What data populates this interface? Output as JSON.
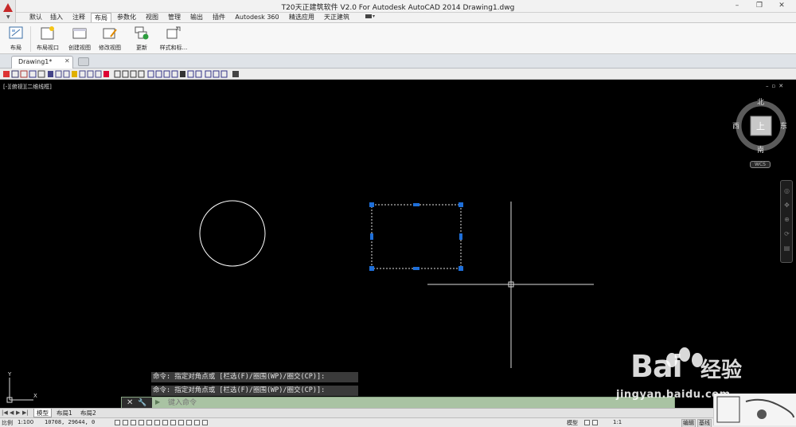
{
  "window": {
    "title": "T20天正建筑软件 V2.0 For Autodesk AutoCAD 2014    Drawing1.dwg",
    "minimize": "–",
    "maximize": "❐",
    "close": "✕"
  },
  "ribbon_tabs": [
    "默认",
    "插入",
    "注释",
    "布局",
    "参数化",
    "视图",
    "管理",
    "输出",
    "插件",
    "Autodesk 360",
    "精选应用",
    "天正建筑"
  ],
  "active_ribbon_tab": "布局",
  "ribbon_buttons": [
    "布局",
    "布局视口",
    "创建视图",
    "修改视图",
    "更新",
    "样式和标..."
  ],
  "document_tab": {
    "label": "Drawing1*",
    "close": "✕"
  },
  "viewport": {
    "label": "[-][俯视][二维线框]",
    "controls": "–▫✕"
  },
  "viewcube": {
    "north": "北",
    "south": "南",
    "east": "东",
    "west": "西",
    "top_face": "上",
    "wcs": "WCS"
  },
  "ucs": {
    "x": "X",
    "y": "Y"
  },
  "command_history": [
    "命令: 指定对角点或 [栏选(F)/圈围(WP)/圈交(CP)]:",
    "命令: 指定对角点或 [栏选(F)/圈围(WP)/圈交(CP)]:"
  ],
  "command_input": {
    "placeholder": "键入命令",
    "close": "✕",
    "wrench": "🔧",
    "prompt_icon": "▶"
  },
  "layout_tabs": {
    "nav": [
      "|◀",
      "◀",
      "▶",
      "▶|"
    ],
    "tabs": [
      "模型",
      "布局1",
      "布局2"
    ],
    "active": "模型"
  },
  "status": {
    "scale_label": "比例",
    "scale_value": "1:100",
    "coordinates": "10708, 29644, 0",
    "model_label": "模型",
    "annotation_scale": "1:1",
    "edit_label": "编辑",
    "base_label": "基线"
  },
  "watermark": {
    "brand": "Bai",
    "cn": "经验",
    "url": "jingyan.baidu.com"
  },
  "colors": {
    "canvas": "#000000",
    "selection_grip": "#1e6fd9",
    "command_bar": "#a9c3a3"
  }
}
